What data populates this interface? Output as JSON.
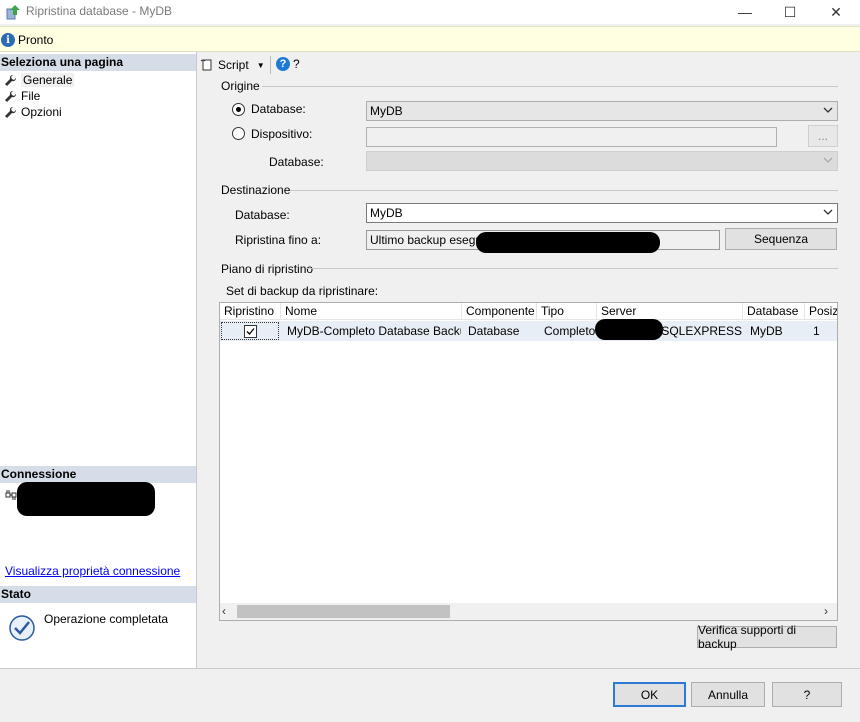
{
  "window": {
    "title": "Ripristina database - MyDB",
    "minimize_glyph": "—",
    "maximize_glyph": "☐",
    "close_glyph": "✕"
  },
  "status_bar": {
    "icon": "info-icon",
    "text": "Pronto"
  },
  "left_pane": {
    "select_page_header": "Seleziona una pagina",
    "pages": [
      {
        "label": "Generale",
        "icon": "wrench-icon",
        "selected": true
      },
      {
        "label": "File",
        "icon": "wrench-icon",
        "selected": false
      },
      {
        "label": "Opzioni",
        "icon": "wrench-icon",
        "selected": false
      }
    ],
    "connection_header": "Connessione",
    "connection_link": "Visualizza proprietà connessione",
    "status_header": "Stato",
    "status_text": "Operazione completata"
  },
  "toolbar": {
    "script_label": "Script",
    "help_label": "?"
  },
  "origin": {
    "header": "Origine",
    "database_radio_label": "Database:",
    "database_value": "MyDB",
    "device_radio_label": "Dispositivo:",
    "device_value": "",
    "browse_label": "...",
    "device_database_label": "Database:",
    "device_database_value": ""
  },
  "destination": {
    "header": "Destinazione",
    "database_label": "Database:",
    "database_value": "MyDB",
    "restore_to_label": "Ripristina fino a:",
    "restore_to_value": "Ultimo backup eseguito",
    "timeline_button": "Sequenza"
  },
  "restore_plan": {
    "header": "Piano di ripristino",
    "backup_sets_label": "Set di backup da ripristinare:",
    "columns": [
      "Ripristino",
      "Nome",
      "Componente",
      "Tipo",
      "Server",
      "Database",
      "Posizi"
    ],
    "rows": [
      {
        "restore": true,
        "name": "MyDB-Completo Database Backup",
        "component": "Database",
        "type": "Completo",
        "server": "\\SQLEXPRESS",
        "database": "MyDB",
        "position": "1"
      }
    ],
    "verify_button": "Verifica supporti di backup"
  },
  "footer": {
    "ok": "OK",
    "cancel": "Annulla",
    "help": "?"
  },
  "colors": {
    "accent": "#2c7ad6",
    "section_header": "#d5dde8",
    "link": "#0000ee",
    "selected_row": "#e8eef6"
  }
}
